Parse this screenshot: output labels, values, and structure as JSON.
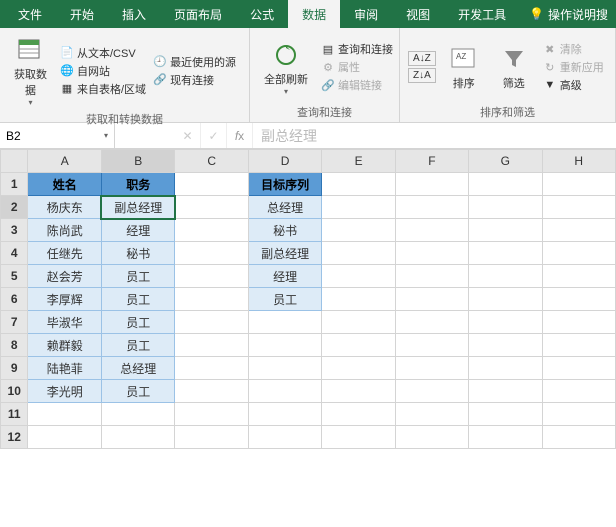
{
  "tabs": {
    "items": [
      "文件",
      "开始",
      "插入",
      "页面布局",
      "公式",
      "数据",
      "审阅",
      "视图",
      "开发工具"
    ],
    "active": 5,
    "help_icon": "lightbulb-icon",
    "help_text": "操作说明搜"
  },
  "ribbon": {
    "group1": {
      "label": "获取和转换数据",
      "big": "获取数\n据",
      "items": [
        "从文本/CSV",
        "自网站",
        "来自表格/区域",
        "最近使用的源",
        "现有连接"
      ]
    },
    "group2": {
      "label": "查询和连接",
      "big": "全部刷新",
      "items": [
        "查询和连接",
        "属性",
        "编辑链接"
      ]
    },
    "group3": {
      "label": "排序和筛选",
      "sort": "排序",
      "filter": "筛选",
      "items": [
        "清除",
        "重新应用",
        "高级"
      ]
    }
  },
  "namebox": "B2",
  "formula": "副总经理",
  "columns": [
    "A",
    "B",
    "C",
    "D",
    "E",
    "F",
    "G",
    "H"
  ],
  "rows": 12,
  "headerA": "姓名",
  "headerB": "职务",
  "headerD": "目标序列",
  "tableAB": [
    [
      "杨庆东",
      "副总经理"
    ],
    [
      "陈尚武",
      "经理"
    ],
    [
      "任继先",
      "秘书"
    ],
    [
      "赵会芳",
      "员工"
    ],
    [
      "李厚辉",
      "员工"
    ],
    [
      "毕淑华",
      "员工"
    ],
    [
      "赖群毅",
      "员工"
    ],
    [
      "陆艳菲",
      "总经理"
    ],
    [
      "李光明",
      "员工"
    ]
  ],
  "tableD": [
    "总经理",
    "秘书",
    "副总经理",
    "经理",
    "员工"
  ],
  "selected": {
    "col": "B",
    "row": 2
  }
}
